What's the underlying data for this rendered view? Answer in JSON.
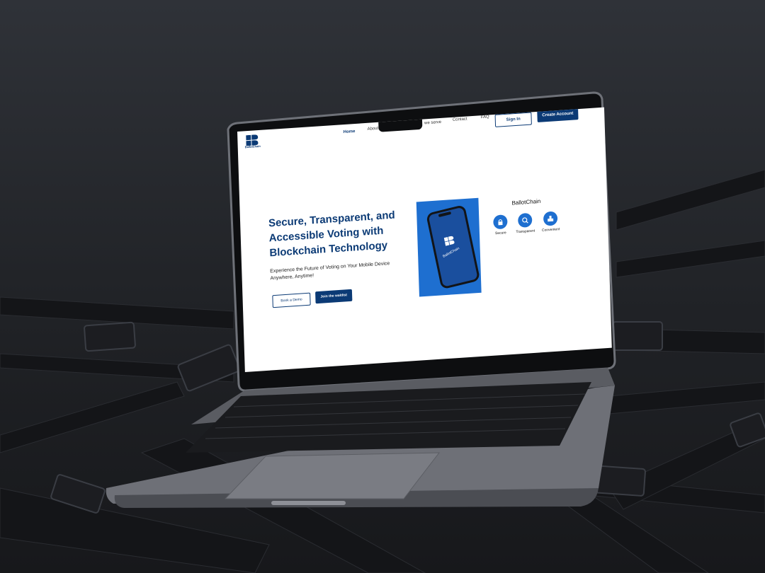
{
  "page": {
    "brand": "BallotChain",
    "nav": {
      "items": [
        "Home",
        "About Us",
        "we serve",
        "Contact",
        "FAQ"
      ],
      "active": "Home",
      "sign_in": "Sign In",
      "create_account": "Create Account"
    },
    "hero": {
      "headline": "Secure, Transparent, and Accessible Voting with Blockchain Technology",
      "subtitle": "Experience the Future of Voting on Your Mobile Device Anywhere, Anytime!",
      "book_demo": "Book a Demo",
      "join_waitlist": "Join the waitlist"
    },
    "phone_brand": "BallotChain",
    "features_title": "BallotChain",
    "features": [
      {
        "label": "Secure",
        "icon": "lock-icon"
      },
      {
        "label": "Transparent",
        "icon": "magnify-icon"
      },
      {
        "label": "Convenient",
        "icon": "ballot-box-icon"
      }
    ]
  },
  "colors": {
    "brand_navy": "#0b3a75",
    "accent_blue": "#1e6fd0",
    "background": "#202226"
  }
}
